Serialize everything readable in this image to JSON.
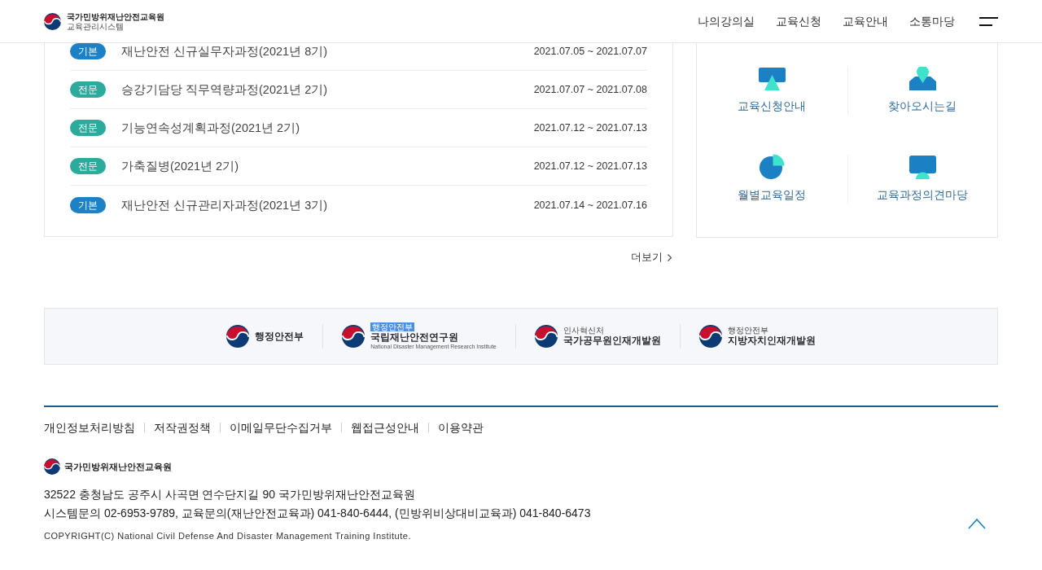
{
  "header": {
    "logo": {
      "title": "국가민방위재난안전교육원",
      "subtitle": "교육관리시스템"
    },
    "nav": [
      "나의강의실",
      "교육신청",
      "교육안내",
      "소통마당"
    ]
  },
  "courses": [
    {
      "category": "기본",
      "color": "#1d82c5",
      "title": "재난안전 신규실무자과정(2021년 8기)",
      "period": "2021.07.05 ~ 2021.07.07"
    },
    {
      "category": "전문",
      "color": "#2cab9d",
      "title": "승강기담당 직무역량과정(2021년 2기)",
      "period": "2021.07.07 ~ 2021.07.08"
    },
    {
      "category": "전문",
      "color": "#2cab9d",
      "title": "기능연속성계획과정(2021년 2기)",
      "period": "2021.07.12 ~ 2021.07.13"
    },
    {
      "category": "전문",
      "color": "#2cab9d",
      "title": "가축질병(2021년 2기)",
      "period": "2021.07.12 ~ 2021.07.13"
    },
    {
      "category": "기본",
      "color": "#1d82c5",
      "title": "재난안전 신규관리자과정(2021년 3기)",
      "period": "2021.07.14 ~ 2021.07.16"
    }
  ],
  "more_link": {
    "label": "더보기"
  },
  "quick_links": [
    {
      "kind": "presentation",
      "label": "교육신청안내"
    },
    {
      "kind": "location",
      "label": "찾아오시는길"
    },
    {
      "kind": "pie",
      "label": "월별교육일정"
    },
    {
      "kind": "screen",
      "label": "교육과정의견마당"
    }
  ],
  "partners": [
    {
      "name": "행정안전부"
    },
    {
      "badge": "행정안전부",
      "name": "국립재난안전연구원",
      "subtitle": "National Disaster Management Research Institute"
    },
    {
      "overline": "인사혁신처",
      "name": "국가공무원인재개발원"
    },
    {
      "overline": "행정안전부",
      "name": "지방자치인재개발원"
    }
  ],
  "footer": {
    "links": [
      "개인정보처리방침",
      "저작권정책",
      "이메일무단수집거부",
      "웹접근성안내",
      "이용약관"
    ],
    "logo_title": "국가민방위재난안전교육원",
    "address": "32522 충청남도 공주시 사곡면 연수단지길 90 국가민방위재난안전교육원",
    "contact": "시스템문의 02-6953-9789, 교육문의(재난안전교육과) 041-840-6444, (민방위비상대비교육과) 041-840-6473",
    "copyright": "COPYRIGHT(C) National Civil Defense And Disaster Management Training Institute."
  }
}
